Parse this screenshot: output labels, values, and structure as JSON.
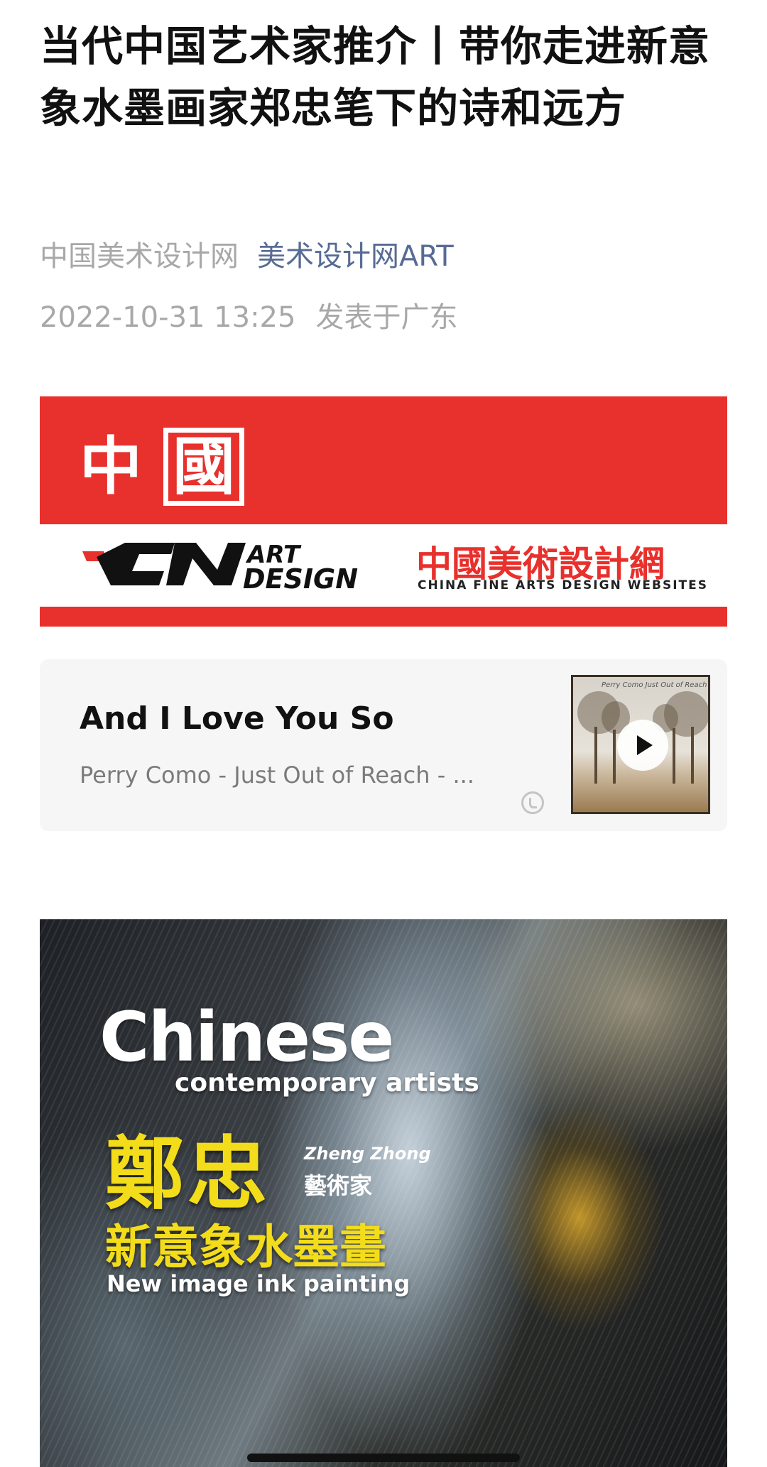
{
  "article": {
    "title": "当代中国艺术家推介丨带你走进新意象水墨画家郑忠笔下的诗和远方",
    "author": "中国美术设计网",
    "account": "美术设计网ART",
    "date": "2022-10-31 13:25",
    "location": "发表于广东"
  },
  "banner": {
    "country": "中",
    "country2": "國",
    "logo_text": "CNART DESIGN",
    "site_name": "中國美術設計網",
    "site_subtitle": "CHINA FINE ARTS DESIGN WEBSITES",
    "brand_color": "#e8302c"
  },
  "music": {
    "title": "And I Love You So",
    "artist": "Perry Como - Just Out of Reach - ...",
    "cover_text": "Perry Como  Just Out of Reach",
    "play_icon": "play-icon",
    "logo_icon": "music-note-icon"
  },
  "poster": {
    "line1": "Chinese",
    "line2": "contemporary artists",
    "name": "鄭忠",
    "name_en": "Zheng Zhong",
    "role": "藝術家",
    "style": "新意象水墨畫",
    "style_en": "New image ink painting",
    "accent_color": "#f3dc1a"
  }
}
